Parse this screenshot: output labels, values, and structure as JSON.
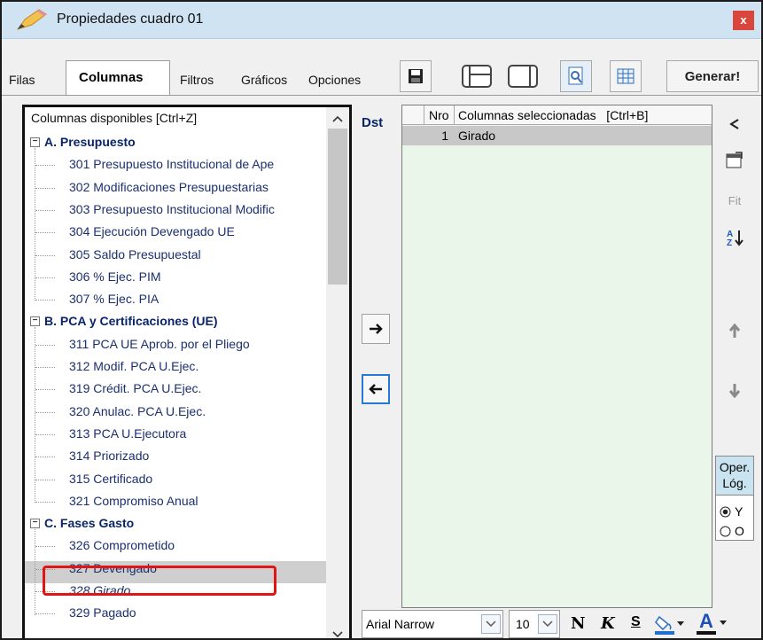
{
  "window": {
    "title": "Propiedades cuadro 01",
    "close_label": "x"
  },
  "tabs": [
    {
      "label": "Filas"
    },
    {
      "label": "Columnas"
    },
    {
      "label": "Filtros"
    },
    {
      "label": "Gráficos"
    },
    {
      "label": "Opciones"
    }
  ],
  "toolbar": {
    "icons": [
      "save-icon",
      "layout-icon",
      "split-view-icon",
      "preview-icon",
      "table-icon"
    ],
    "generate_label": "Generar!"
  },
  "available": {
    "header": "Columnas disponibles    [Ctrl+Z]",
    "groups": [
      {
        "label": "A. Presupuesto",
        "items": [
          "301 Presupuesto Institucional de Ape",
          "302 Modificaciones Presupuestarias",
          "303 Presupuesto Institucional Modific",
          "304 Ejecución Devengado UE",
          "305 Saldo Presupuestal",
          "306 % Ejec. PIM",
          "307 % Ejec. PIA"
        ]
      },
      {
        "label": "B. PCA y Certificaciones (UE)",
        "items": [
          "311 PCA UE Aprob. por el Pliego",
          "312 Modif. PCA U.Ejec.",
          "319 Crédit. PCA U.Ejec.",
          "320 Anulac. PCA U.Ejec.",
          "313 PCA U.Ejecutora",
          "314 Priorizado",
          "315 Certificado",
          "321 Compromiso Anual"
        ]
      },
      {
        "label": "C. Fases Gasto",
        "items": [
          "326 Comprometido",
          "327 Devengado",
          "328 Girado",
          "329 Pagado"
        ]
      }
    ],
    "selected_item": "328 Girado"
  },
  "dst_label": "Dst",
  "selected": {
    "nro_header": "Nro",
    "columns_header": "Columnas seleccionadas   [Ctrl+B]",
    "rows": [
      {
        "nro": "1",
        "name": "Girado"
      }
    ]
  },
  "right_toolbar": {
    "fit_label": "Fit"
  },
  "oper": {
    "title_line1": "Oper.",
    "title_line2": "Lóg.",
    "option_y": "Y",
    "option_o": "O",
    "selected": "Y"
  },
  "format": {
    "font": "Arial Narrow",
    "size": "10",
    "bold": "N",
    "italic": "K",
    "underline": "S",
    "font_color_label": "A"
  }
}
